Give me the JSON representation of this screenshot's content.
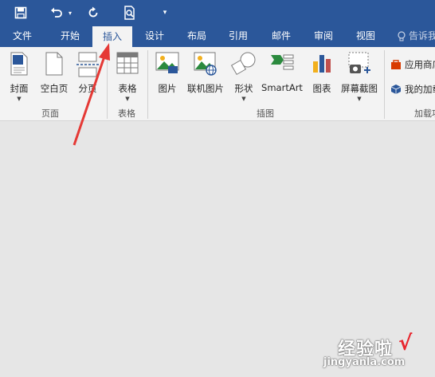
{
  "qat": {
    "save_icon": "save-icon",
    "undo_icon": "undo-icon",
    "redo_icon": "redo-icon",
    "print_preview_icon": "print-preview-icon",
    "customize_icon": "customize-qat-icon"
  },
  "tabs": [
    {
      "label": "文件"
    },
    {
      "label": "开始"
    },
    {
      "label": "插入",
      "active": true
    },
    {
      "label": "设计"
    },
    {
      "label": "布局"
    },
    {
      "label": "引用"
    },
    {
      "label": "邮件"
    },
    {
      "label": "审阅"
    },
    {
      "label": "视图"
    }
  ],
  "tellme": {
    "label": "告诉我",
    "icon": "lightbulb-icon"
  },
  "ribbon": {
    "pages": {
      "group_label": "页面",
      "cover": "封面",
      "blank_page": "空白页",
      "page_break": "分页"
    },
    "tables": {
      "group_label": "表格",
      "table": "表格"
    },
    "illustrations": {
      "group_label": "插图",
      "picture": "图片",
      "online_picture": "联机图片",
      "shapes": "形状",
      "smartart": "SmartArt",
      "chart": "图表",
      "screenshot": "屏幕截图"
    },
    "addins": {
      "group_label": "加载项",
      "store": "应用商店",
      "my_addins": "我的加载项"
    }
  },
  "watermark": {
    "text": "经验啦",
    "check": "√",
    "url": "jingyanla.com"
  },
  "colors": {
    "title_bar": "#2b579a",
    "ribbon": "#f3f3f3",
    "canvas": "#e6e6e6",
    "arrow": "#e53935"
  }
}
